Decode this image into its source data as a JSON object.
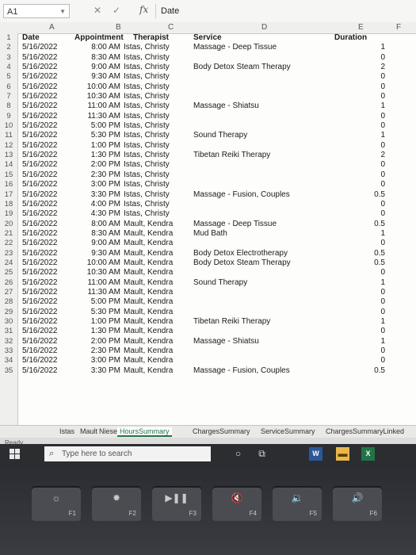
{
  "formula_bar": {
    "cell_ref": "A1",
    "formula": "Date"
  },
  "columns": [
    "A",
    "B",
    "C",
    "D",
    "E",
    "F"
  ],
  "row_numbers": [
    "1",
    "2",
    "3",
    "4",
    "5",
    "6",
    "7",
    "8",
    "9",
    "10",
    "11",
    "12",
    "13",
    "14",
    "15",
    "16",
    "17",
    "18",
    "19",
    "20",
    "21",
    "22",
    "23",
    "24",
    "25",
    "26",
    "27",
    "28",
    "29",
    "30",
    "31",
    "32",
    "33",
    "34",
    "35"
  ],
  "header_row": {
    "date": "Date",
    "appointment": "Appointment",
    "therapist": "Therapist",
    "service": "Service",
    "duration": "Duration"
  },
  "rows": [
    {
      "date": "5/16/2022",
      "time": "8:00 AM",
      "therapist": "Istas, Christy",
      "service": "Massage - Deep Tissue",
      "duration": "1"
    },
    {
      "date": "5/16/2022",
      "time": "8:30 AM",
      "therapist": "Istas, Christy",
      "service": "",
      "duration": "0"
    },
    {
      "date": "5/16/2022",
      "time": "9:00 AM",
      "therapist": "Istas, Christy",
      "service": "Body Detox Steam Therapy",
      "duration": "2"
    },
    {
      "date": "5/16/2022",
      "time": "9:30 AM",
      "therapist": "Istas, Christy",
      "service": "",
      "duration": "0"
    },
    {
      "date": "5/16/2022",
      "time": "10:00 AM",
      "therapist": "Istas, Christy",
      "service": "",
      "duration": "0"
    },
    {
      "date": "5/16/2022",
      "time": "10:30 AM",
      "therapist": "Istas, Christy",
      "service": "",
      "duration": "0"
    },
    {
      "date": "5/16/2022",
      "time": "11:00 AM",
      "therapist": "Istas, Christy",
      "service": "Massage - Shiatsu",
      "duration": "1"
    },
    {
      "date": "5/16/2022",
      "time": "11:30 AM",
      "therapist": "Istas, Christy",
      "service": "",
      "duration": "0"
    },
    {
      "date": "5/16/2022",
      "time": "5:00 PM",
      "therapist": "Istas, Christy",
      "service": "",
      "duration": "0"
    },
    {
      "date": "5/16/2022",
      "time": "5:30 PM",
      "therapist": "Istas, Christy",
      "service": "Sound Therapy",
      "duration": "1"
    },
    {
      "date": "5/16/2022",
      "time": "1:00 PM",
      "therapist": "Istas, Christy",
      "service": "",
      "duration": "0"
    },
    {
      "date": "5/16/2022",
      "time": "1:30 PM",
      "therapist": "Istas, Christy",
      "service": "Tibetan Reiki Therapy",
      "duration": "2"
    },
    {
      "date": "5/16/2022",
      "time": "2:00 PM",
      "therapist": "Istas, Christy",
      "service": "",
      "duration": "0"
    },
    {
      "date": "5/16/2022",
      "time": "2:30 PM",
      "therapist": "Istas, Christy",
      "service": "",
      "duration": "0"
    },
    {
      "date": "5/16/2022",
      "time": "3:00 PM",
      "therapist": "Istas, Christy",
      "service": "",
      "duration": "0"
    },
    {
      "date": "5/16/2022",
      "time": "3:30 PM",
      "therapist": "Istas, Christy",
      "service": "Massage - Fusion, Couples",
      "duration": "0.5"
    },
    {
      "date": "5/16/2022",
      "time": "4:00 PM",
      "therapist": "Istas, Christy",
      "service": "",
      "duration": "0"
    },
    {
      "date": "5/16/2022",
      "time": "4:30 PM",
      "therapist": "Istas, Christy",
      "service": "",
      "duration": "0"
    },
    {
      "date": "5/16/2022",
      "time": "8:00 AM",
      "therapist": "Mault, Kendra",
      "service": "Massage - Deep Tissue",
      "duration": "0.5"
    },
    {
      "date": "5/16/2022",
      "time": "8:30 AM",
      "therapist": "Mault, Kendra",
      "service": "Mud Bath",
      "duration": "1"
    },
    {
      "date": "5/16/2022",
      "time": "9:00 AM",
      "therapist": "Mault, Kendra",
      "service": "",
      "duration": "0"
    },
    {
      "date": "5/16/2022",
      "time": "9:30 AM",
      "therapist": "Mault, Kendra",
      "service": "Body Detox Electrotherapy",
      "duration": "0.5"
    },
    {
      "date": "5/16/2022",
      "time": "10:00 AM",
      "therapist": "Mault, Kendra",
      "service": "Body Detox Steam Therapy",
      "duration": "0.5"
    },
    {
      "date": "5/16/2022",
      "time": "10:30 AM",
      "therapist": "Mault, Kendra",
      "service": "",
      "duration": "0"
    },
    {
      "date": "5/16/2022",
      "time": "11:00 AM",
      "therapist": "Mault, Kendra",
      "service": "Sound Therapy",
      "duration": "1"
    },
    {
      "date": "5/16/2022",
      "time": "11:30 AM",
      "therapist": "Mault, Kendra",
      "service": "",
      "duration": "0"
    },
    {
      "date": "5/16/2022",
      "time": "5:00 PM",
      "therapist": "Mault, Kendra",
      "service": "",
      "duration": "0"
    },
    {
      "date": "5/16/2022",
      "time": "5:30 PM",
      "therapist": "Mault, Kendra",
      "service": "",
      "duration": "0"
    },
    {
      "date": "5/16/2022",
      "time": "1:00 PM",
      "therapist": "Mault, Kendra",
      "service": "Tibetan Reiki Therapy",
      "duration": "1"
    },
    {
      "date": "5/16/2022",
      "time": "1:30 PM",
      "therapist": "Mault, Kendra",
      "service": "",
      "duration": "0"
    },
    {
      "date": "5/16/2022",
      "time": "2:00 PM",
      "therapist": "Mault, Kendra",
      "service": "Massage - Shiatsu",
      "duration": "1"
    },
    {
      "date": "5/16/2022",
      "time": "2:30 PM",
      "therapist": "Mault, Kendra",
      "service": "",
      "duration": "0"
    },
    {
      "date": "5/16/2022",
      "time": "3:00 PM",
      "therapist": "Mault, Kendra",
      "service": "",
      "duration": "0"
    },
    {
      "date": "5/16/2022",
      "time": "3:30 PM",
      "therapist": "Mault, Kendra",
      "service": "Massage - Fusion, Couples",
      "duration": "0.5"
    }
  ],
  "sheet_tabs": [
    "Istas",
    "Mault",
    "Niese",
    "HoursSummary",
    "ChargesSummary",
    "ServiceSummary",
    "ChargesSummaryLinked"
  ],
  "active_tab": "HoursSummary",
  "status_bar": {
    "ready": "Ready"
  },
  "taskbar": {
    "search_placeholder": "Type here to search",
    "icons": [
      "windows-logo",
      "cortana-circle",
      "task-view",
      "word",
      "file-explorer",
      "excel"
    ]
  },
  "keyboard": {
    "keys": [
      {
        "icon": "brightness-down",
        "label": "F1"
      },
      {
        "icon": "brightness-up",
        "label": "F2"
      },
      {
        "icon": "play-pause",
        "label": "F3"
      },
      {
        "icon": "mute",
        "label": "F4"
      },
      {
        "icon": "volume-down",
        "label": "F5"
      },
      {
        "icon": "volume-up",
        "label": "F6"
      }
    ]
  },
  "colors": {
    "excel_green": "#217346",
    "taskbar": "#2b2d31"
  }
}
